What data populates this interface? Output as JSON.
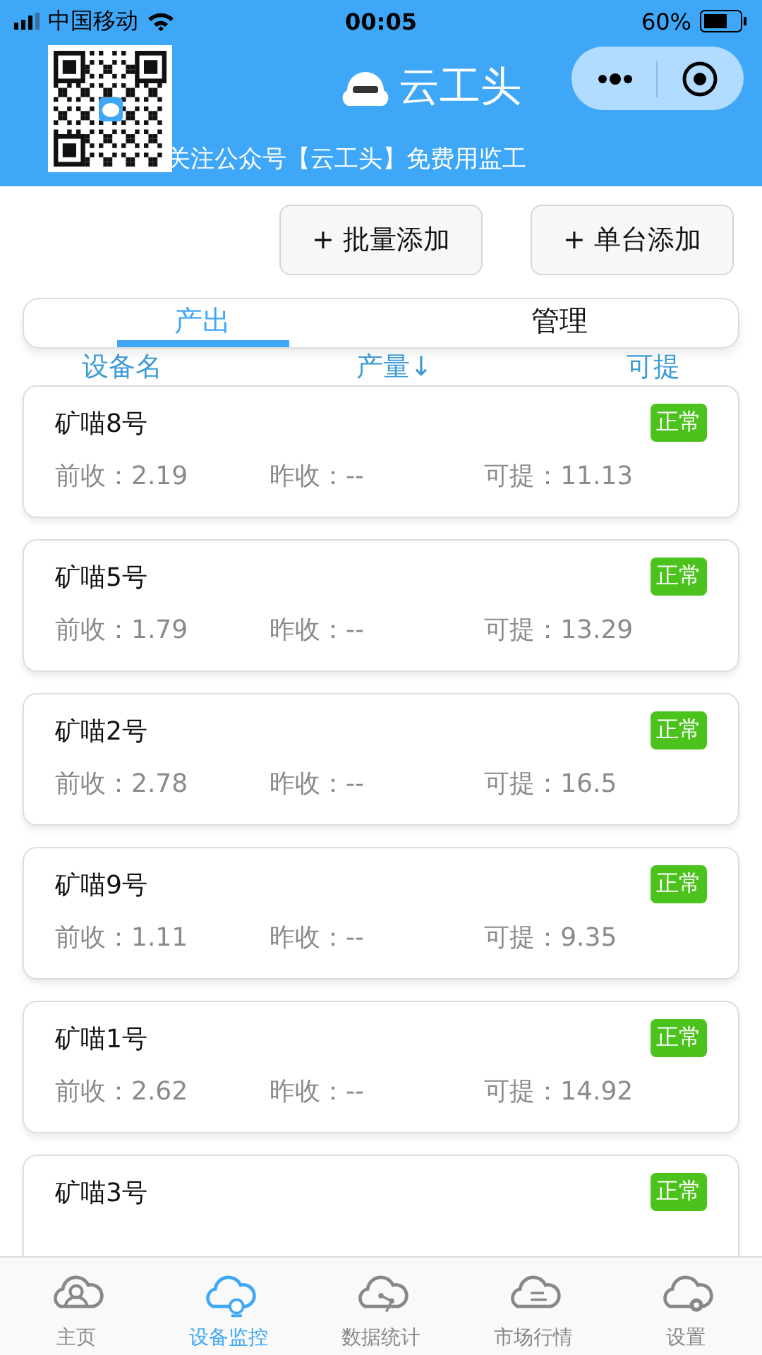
{
  "status_bar": {
    "carrier": "中国移动",
    "time": "00:05",
    "battery": "60%"
  },
  "header": {
    "title": "云工头",
    "subtitle": "关注公众号【云工头】免费用监工"
  },
  "actions": [
    "+ 批量添加",
    "+ 单台添加"
  ],
  "tabs": [
    {
      "label": "产出",
      "selected": true
    },
    {
      "label": "管理",
      "selected": false
    }
  ],
  "columns": [
    "设备名",
    "产量↓",
    "可提"
  ],
  "devices": [
    {
      "name": "矿喵8号",
      "status": "正常",
      "color": "#4cc21d",
      "fields": [
        {
          "label": "前收：",
          "value": "2.19"
        },
        {
          "label": "昨收：",
          "value": "--"
        },
        {
          "label": "可提：",
          "value": "11.13"
        }
      ]
    },
    {
      "name": "矿喵5号",
      "status": "正常",
      "color": "#4cc21d",
      "fields": [
        {
          "label": "前收：",
          "value": "1.79"
        },
        {
          "label": "昨收：",
          "value": "--"
        },
        {
          "label": "可提：",
          "value": "13.29"
        }
      ]
    },
    {
      "name": "矿喵2号",
      "status": "正常",
      "color": "#4cc21d",
      "fields": [
        {
          "label": "前收：",
          "value": "2.78"
        },
        {
          "label": "昨收：",
          "value": "--"
        },
        {
          "label": "可提：",
          "value": "16.5"
        }
      ]
    },
    {
      "name": "矿喵9号",
      "status": "正常",
      "color": "#4cc21d",
      "fields": [
        {
          "label": "前收：",
          "value": "1.11"
        },
        {
          "label": "昨收：",
          "value": "--"
        },
        {
          "label": "可提：",
          "value": "9.35"
        }
      ]
    },
    {
      "name": "矿喵1号",
      "status": "正常",
      "color": "#4cc21d",
      "fields": [
        {
          "label": "前收：",
          "value": "2.62"
        },
        {
          "label": "昨收：",
          "value": "--"
        },
        {
          "label": "可提：",
          "value": "14.92"
        }
      ]
    },
    {
      "name": "矿喵3号",
      "status": "正常",
      "color": "#4cc21d"
    }
  ],
  "nav": [
    {
      "label": "主页",
      "kind": "home",
      "selected": false
    },
    {
      "label": "设备监控",
      "kind": "monitor",
      "selected": true
    },
    {
      "label": "数据统计",
      "kind": "stats",
      "selected": false
    },
    {
      "label": "市场行情",
      "kind": "market",
      "selected": false
    },
    {
      "label": "设置",
      "kind": "settings",
      "selected": false
    }
  ]
}
